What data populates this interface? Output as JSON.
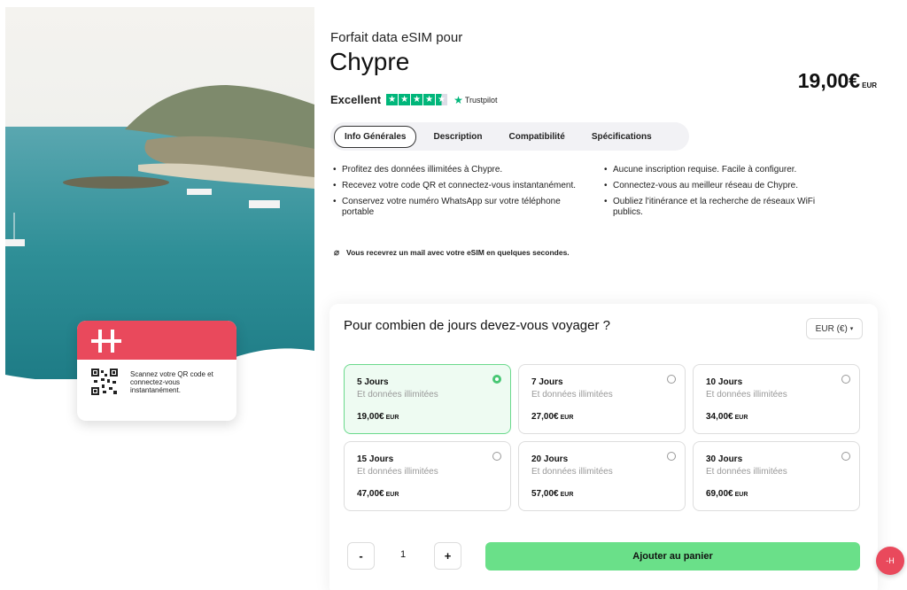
{
  "hero": {
    "card_text": "Scannez votre QR code et connectez-vous instantanément.",
    "brand_color": "#e9495c"
  },
  "product": {
    "subtitle": "Forfait data eSIM pour",
    "title": "Chypre",
    "price": "19,00€",
    "price_currency": "EUR"
  },
  "rating": {
    "label": "Excellent",
    "provider": "Trustpilot",
    "star_icon": "star-icon",
    "accent": "#00b67a"
  },
  "tabs": [
    "Info Générales",
    "Description",
    "Compatibilité",
    "Spécifications"
  ],
  "features_left": [
    "Profitez des données illimitées à Chypre.",
    "Recevez votre code QR et connectez-vous instantanément.",
    "Conservez votre numéro WhatsApp sur votre téléphone portable"
  ],
  "features_right": [
    "Aucune inscription requise. Facile à configurer.",
    "Connectez-vous au meilleur réseau de Chypre.",
    "Oubliez l'itinérance et la recherche de réseaux WiFi publics."
  ],
  "mail_note": "Vous recevrez un mail avec votre eSIM en quelques secondes.",
  "selector": {
    "title": "Pour combien de jours devez-vous voyager ?",
    "currency": "EUR (€)",
    "plans": [
      {
        "name": "5 Jours",
        "desc": "Et données illimitées",
        "price": "19,00€",
        "cur": "EUR",
        "selected": true
      },
      {
        "name": "7 Jours",
        "desc": "Et données illimitées",
        "price": "27,00€",
        "cur": "EUR",
        "selected": false
      },
      {
        "name": "10 Jours",
        "desc": "Et données illimitées",
        "price": "34,00€",
        "cur": "EUR",
        "selected": false
      },
      {
        "name": "15 Jours",
        "desc": "Et données illimitées",
        "price": "47,00€",
        "cur": "EUR",
        "selected": false
      },
      {
        "name": "20 Jours",
        "desc": "Et données illimitées",
        "price": "57,00€",
        "cur": "EUR",
        "selected": false
      },
      {
        "name": "30 Jours",
        "desc": "Et données illimitées",
        "price": "69,00€",
        "cur": "EUR",
        "selected": false
      }
    ],
    "minus": "-",
    "quantity": "1",
    "plus": "+",
    "add_to_cart": "Ajouter au panier",
    "accent": "#6ae089"
  },
  "chat": {
    "label": "-H"
  }
}
